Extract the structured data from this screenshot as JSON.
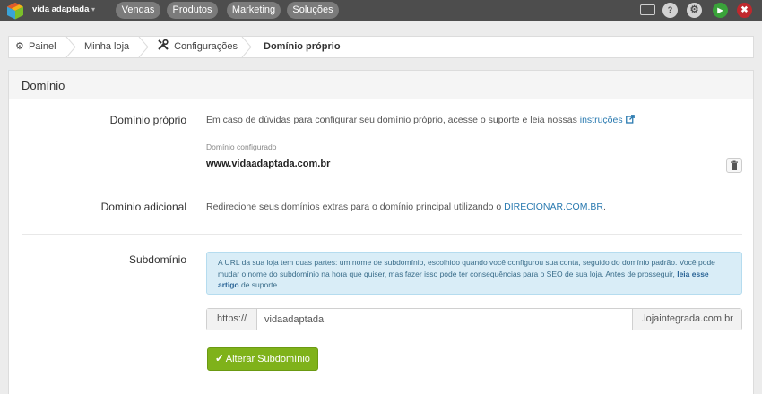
{
  "topbar": {
    "brand": "vida adaptada",
    "caret": "▾",
    "nav": [
      "Vendas",
      "Produtos",
      "Marketing",
      "Soluções"
    ],
    "icons": {
      "monitor": "monitor-icon",
      "help": "?",
      "settings": "⚙",
      "play": "▶",
      "close": "✖"
    },
    "colors": {
      "bar": "#4d4d4d",
      "pill": "#7b7b7b",
      "play": "#3aa33a",
      "close": "#c0282d"
    }
  },
  "breadcrumb": {
    "items": [
      "Painel",
      "Minha loja",
      "Configurações",
      "Domínio próprio"
    ],
    "icons": {
      "painel": "gear-icon",
      "configuracoes": "tools-icon"
    }
  },
  "panel": {
    "title": "Domínio",
    "dominio_proprio": {
      "label": "Domínio próprio",
      "text": "Em caso de dúvidas para configurar seu domínio próprio, acesse o suporte e leia nossas ",
      "link": "instruções",
      "configured_label": "Domínio configurado",
      "configured_value": "www.vidaadaptada.com.br"
    },
    "dominio_adicional": {
      "label": "Domínio adicional",
      "text": "Redirecione seus domínios extras para o domínio principal utilizando o ",
      "link": "DIRECIONAR.COM.BR",
      "suffix": "."
    },
    "subdominio": {
      "label": "Subdomínio",
      "alert_text": "A URL da sua loja tem duas partes: um nome de subdomínio, escolhido quando você configurou sua conta, seguido do domínio padrão. Você pode mudar o nome do subdomínio na hora que quiser, mas fazer isso pode ter consequências para o SEO de sua loja. Antes de prosseguir, ",
      "alert_link": "leia esse artigo",
      "alert_suffix": " de suporte.",
      "prefix": "https://",
      "value": "vidaadaptada",
      "suffix": ".lojaintegrada.com.br",
      "button": "Alterar Subdomínio"
    },
    "colors": {
      "link": "#2a7ab0",
      "alert_bg": "#d9edf7",
      "button": "#7fb21a"
    }
  }
}
